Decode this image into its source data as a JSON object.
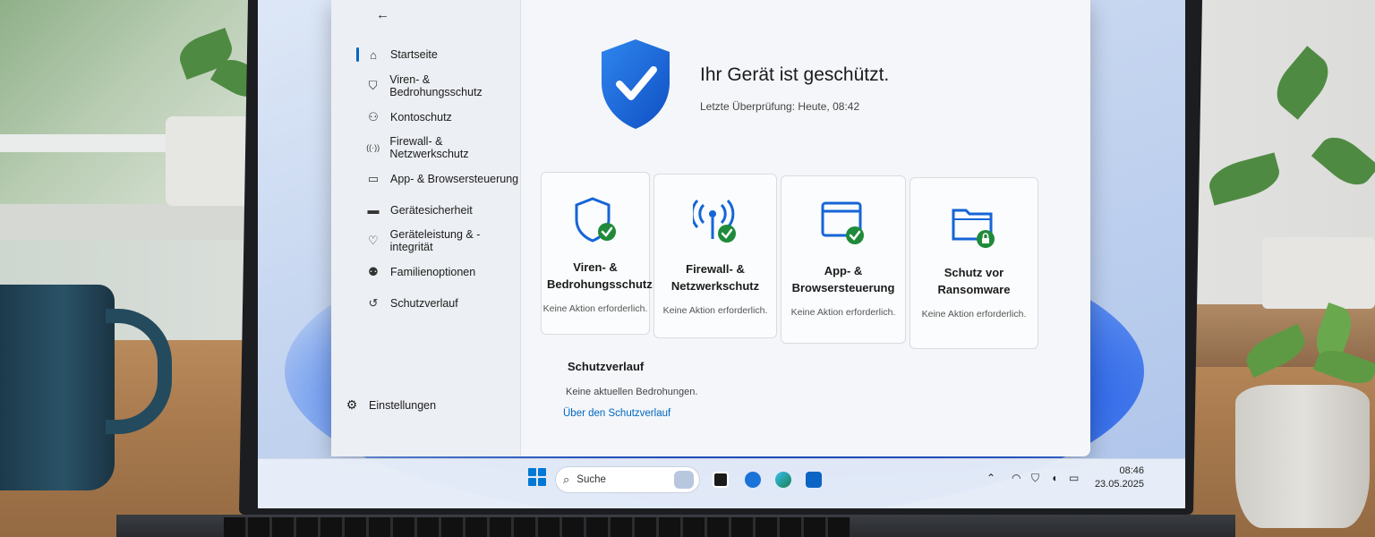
{
  "app": {
    "back_label": "←",
    "sidebar": {
      "items": [
        {
          "label": "Startseite",
          "icon": "home-icon",
          "glyph": "⌂"
        },
        {
          "label": "Viren- & Bedrohungsschutz",
          "icon": "shield-icon",
          "glyph": "⛉"
        },
        {
          "label": "Kontoschutz",
          "icon": "person-icon",
          "glyph": "⚇"
        },
        {
          "label": "Firewall- & Netzwerkschutz",
          "icon": "antenna-icon",
          "glyph": "((·))"
        },
        {
          "label": "App- & Browsersteuerung",
          "icon": "window-icon",
          "glyph": "▭"
        },
        {
          "label": "Gerätesicherheit",
          "icon": "laptop-icon",
          "glyph": "▬"
        },
        {
          "label": "Geräteleistung & -integrität",
          "icon": "heart-icon",
          "glyph": "♡"
        },
        {
          "label": "Familienoptionen",
          "icon": "family-icon",
          "glyph": "⚉"
        },
        {
          "label": "Schutzverlauf",
          "icon": "history-icon",
          "glyph": "↺"
        }
      ],
      "settings_label": "Einstellungen",
      "settings_glyph": "⚙"
    },
    "hero": {
      "title": "Ihr Gerät ist geschützt.",
      "subtitle": "Letzte Überprüfung: Heute, 08:42"
    },
    "cards": [
      {
        "title": "Viren- & Bedrohungsschutz",
        "status": "Keine Aktion erforderlich.",
        "icon": "shield-check-icon"
      },
      {
        "title": "Firewall- & Netzwerkschutz",
        "status": "Keine Aktion erforderlich.",
        "icon": "antenna-check-icon"
      },
      {
        "title": "App- & Browsersteuerung",
        "status": "Keine Aktion erforderlich.",
        "icon": "browser-check-icon"
      },
      {
        "title": "Schutz vor Ransomware",
        "status": "Keine Aktion erforderlich.",
        "icon": "folder-lock-icon"
      }
    ],
    "history": {
      "title": "Schutzverlauf",
      "status": "Keine aktuellen Bedrohungen.",
      "link": "Über den Schutzverlauf"
    }
  },
  "taskbar": {
    "search_placeholder": "Suche",
    "time": "08:46",
    "date": "23.05.2025"
  },
  "colors": {
    "accent": "#0067c0",
    "shield_blue": "#1565d8",
    "ok_green": "#1f8a3a"
  }
}
